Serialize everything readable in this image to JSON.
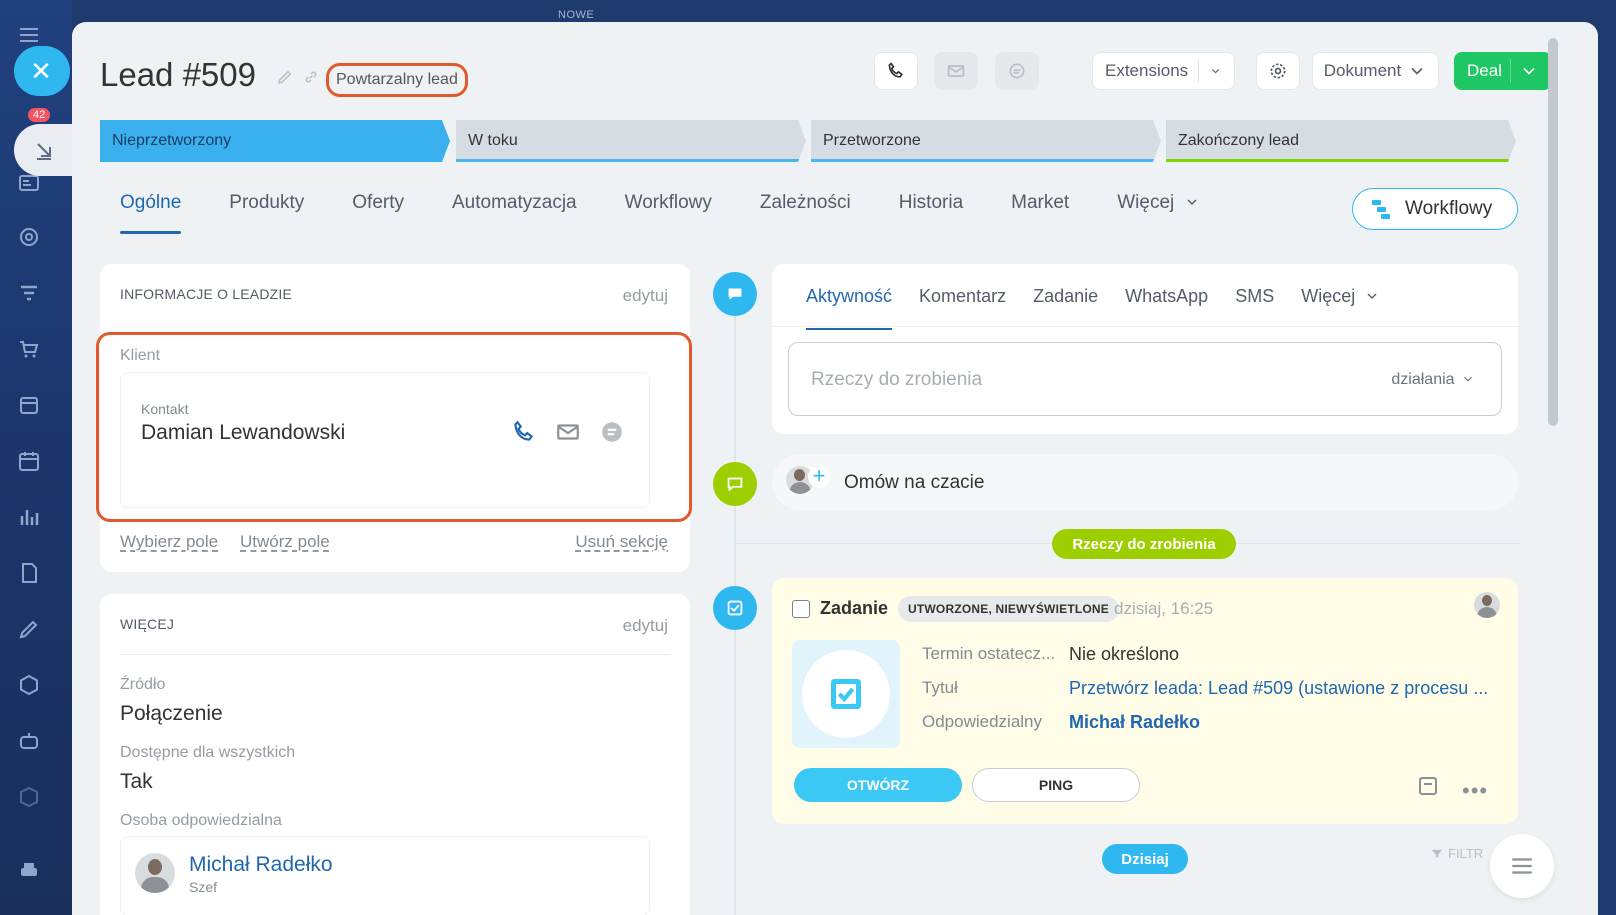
{
  "top_label": "NOWE",
  "sidebar": {
    "badge": "42"
  },
  "header": {
    "title": "Lead #509",
    "tag": "Powtarzalny lead",
    "extensions_label": "Extensions",
    "document_label": "Dokument",
    "deal_label": "Deal"
  },
  "stages": [
    {
      "label": "Nieprzetworzony",
      "active": true,
      "color": "#3bb0ee"
    },
    {
      "label": "W toku",
      "active": false,
      "color": "#48b8e8"
    },
    {
      "label": "Przetworzone",
      "active": false,
      "color": "#48b8e8"
    },
    {
      "label": "Zakończony lead",
      "active": false,
      "color": "#7bd500"
    }
  ],
  "tabs": [
    "Ogólne",
    "Produkty",
    "Oferty",
    "Automatyzacja",
    "Workflowy",
    "Zależności",
    "Historia",
    "Market",
    "Więcej"
  ],
  "workflow_button": "Workflowy",
  "info": {
    "title": "INFORMACJE O LEADZIE",
    "edit": "edytuj",
    "client_label": "Klient",
    "contact_sub": "Kontakt",
    "contact_name": "Damian Lewandowski",
    "select_field": "Wybierz pole",
    "create_field": "Utwórz pole",
    "remove_section": "Usuń sekcję"
  },
  "more": {
    "title": "WIĘCEJ",
    "edit": "edytuj",
    "source_label": "Źródło",
    "source_value": "Połączenie",
    "available_label": "Dostępne dla wszystkich",
    "available_value": "Tak",
    "responsible_label": "Osoba odpowiedzialna",
    "person_name": "Michał Radełko",
    "person_role": "Szef"
  },
  "activity": {
    "tabs": [
      "Aktywność",
      "Komentarz",
      "Zadanie",
      "WhatsApp",
      "SMS",
      "Więcej"
    ],
    "placeholder": "Rzeczy do zrobienia",
    "actions": "działania"
  },
  "chat": {
    "text": "Omów na czacie"
  },
  "pills": {
    "todo": "Rzeczy do zrobienia",
    "today": "Dzisiaj"
  },
  "task": {
    "title": "Zadanie",
    "badge": "UTWORZONE, NIEWYŚWIETLONE",
    "time": "dzisiaj, 16:25",
    "deadline_label": "Termin ostatecz...",
    "deadline_value": "Nie określono",
    "title_label": "Tytuł",
    "title_value": "Przetwórz leada: Lead #509 (ustawione z procesu ...",
    "responsible_label": "Odpowiedzialny",
    "responsible_value": "Michał Radełko",
    "open_button": "OTWÓRZ",
    "ping_button": "PING"
  },
  "filter_label": "FILTR"
}
